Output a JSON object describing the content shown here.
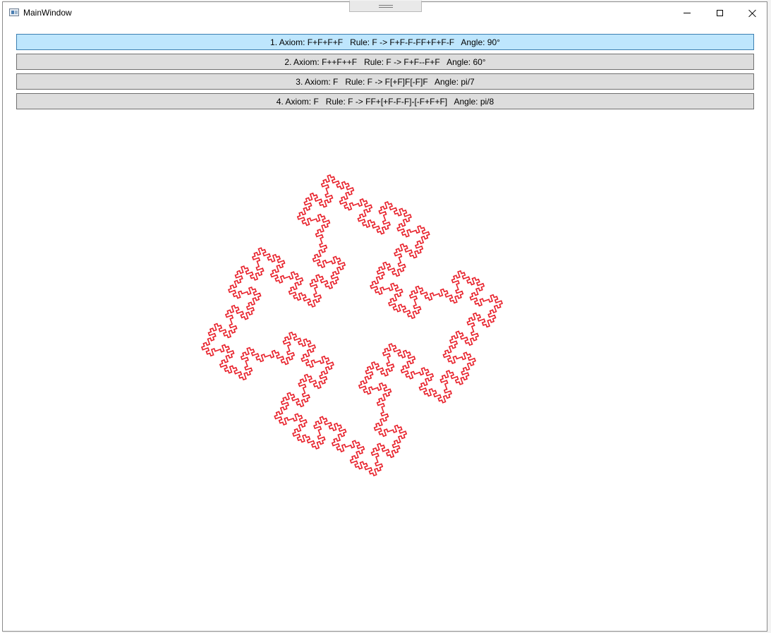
{
  "window": {
    "title": "MainWindow",
    "controls": {
      "minimize": "minimize-icon",
      "maximize": "maximize-icon",
      "close": "close-icon"
    }
  },
  "buttons": [
    {
      "label": "1. Axiom: F+F+F+F   Rule: F -> F+F-F-FF+F+F-F   Angle: 90°",
      "active": true
    },
    {
      "label": "2. Axiom: F++F++F   Rule: F -> F+F--F+F   Angle: 60°",
      "active": false
    },
    {
      "label": "3. Axiom: F   Rule: F -> F[+F]F[-F]F   Angle: pi/7",
      "active": false
    },
    {
      "label": "4. Axiom: F   Rule: F -> FF+[+F-F-F]-[-F+F+F]   Angle: pi/8",
      "active": false
    }
  ],
  "lsystem": {
    "axiom": "F+F+F+F",
    "rule": "F+F-F-FF+F+F-F",
    "angle_deg": 90,
    "iterations": 3,
    "stroke_color": "#e8202a",
    "rotation_deg": -20
  },
  "colors": {
    "button_bg": "#dddddd",
    "button_active_bg": "#bee6fd",
    "button_active_border": "#3c7fb1",
    "fractal_stroke": "#e8202a"
  }
}
